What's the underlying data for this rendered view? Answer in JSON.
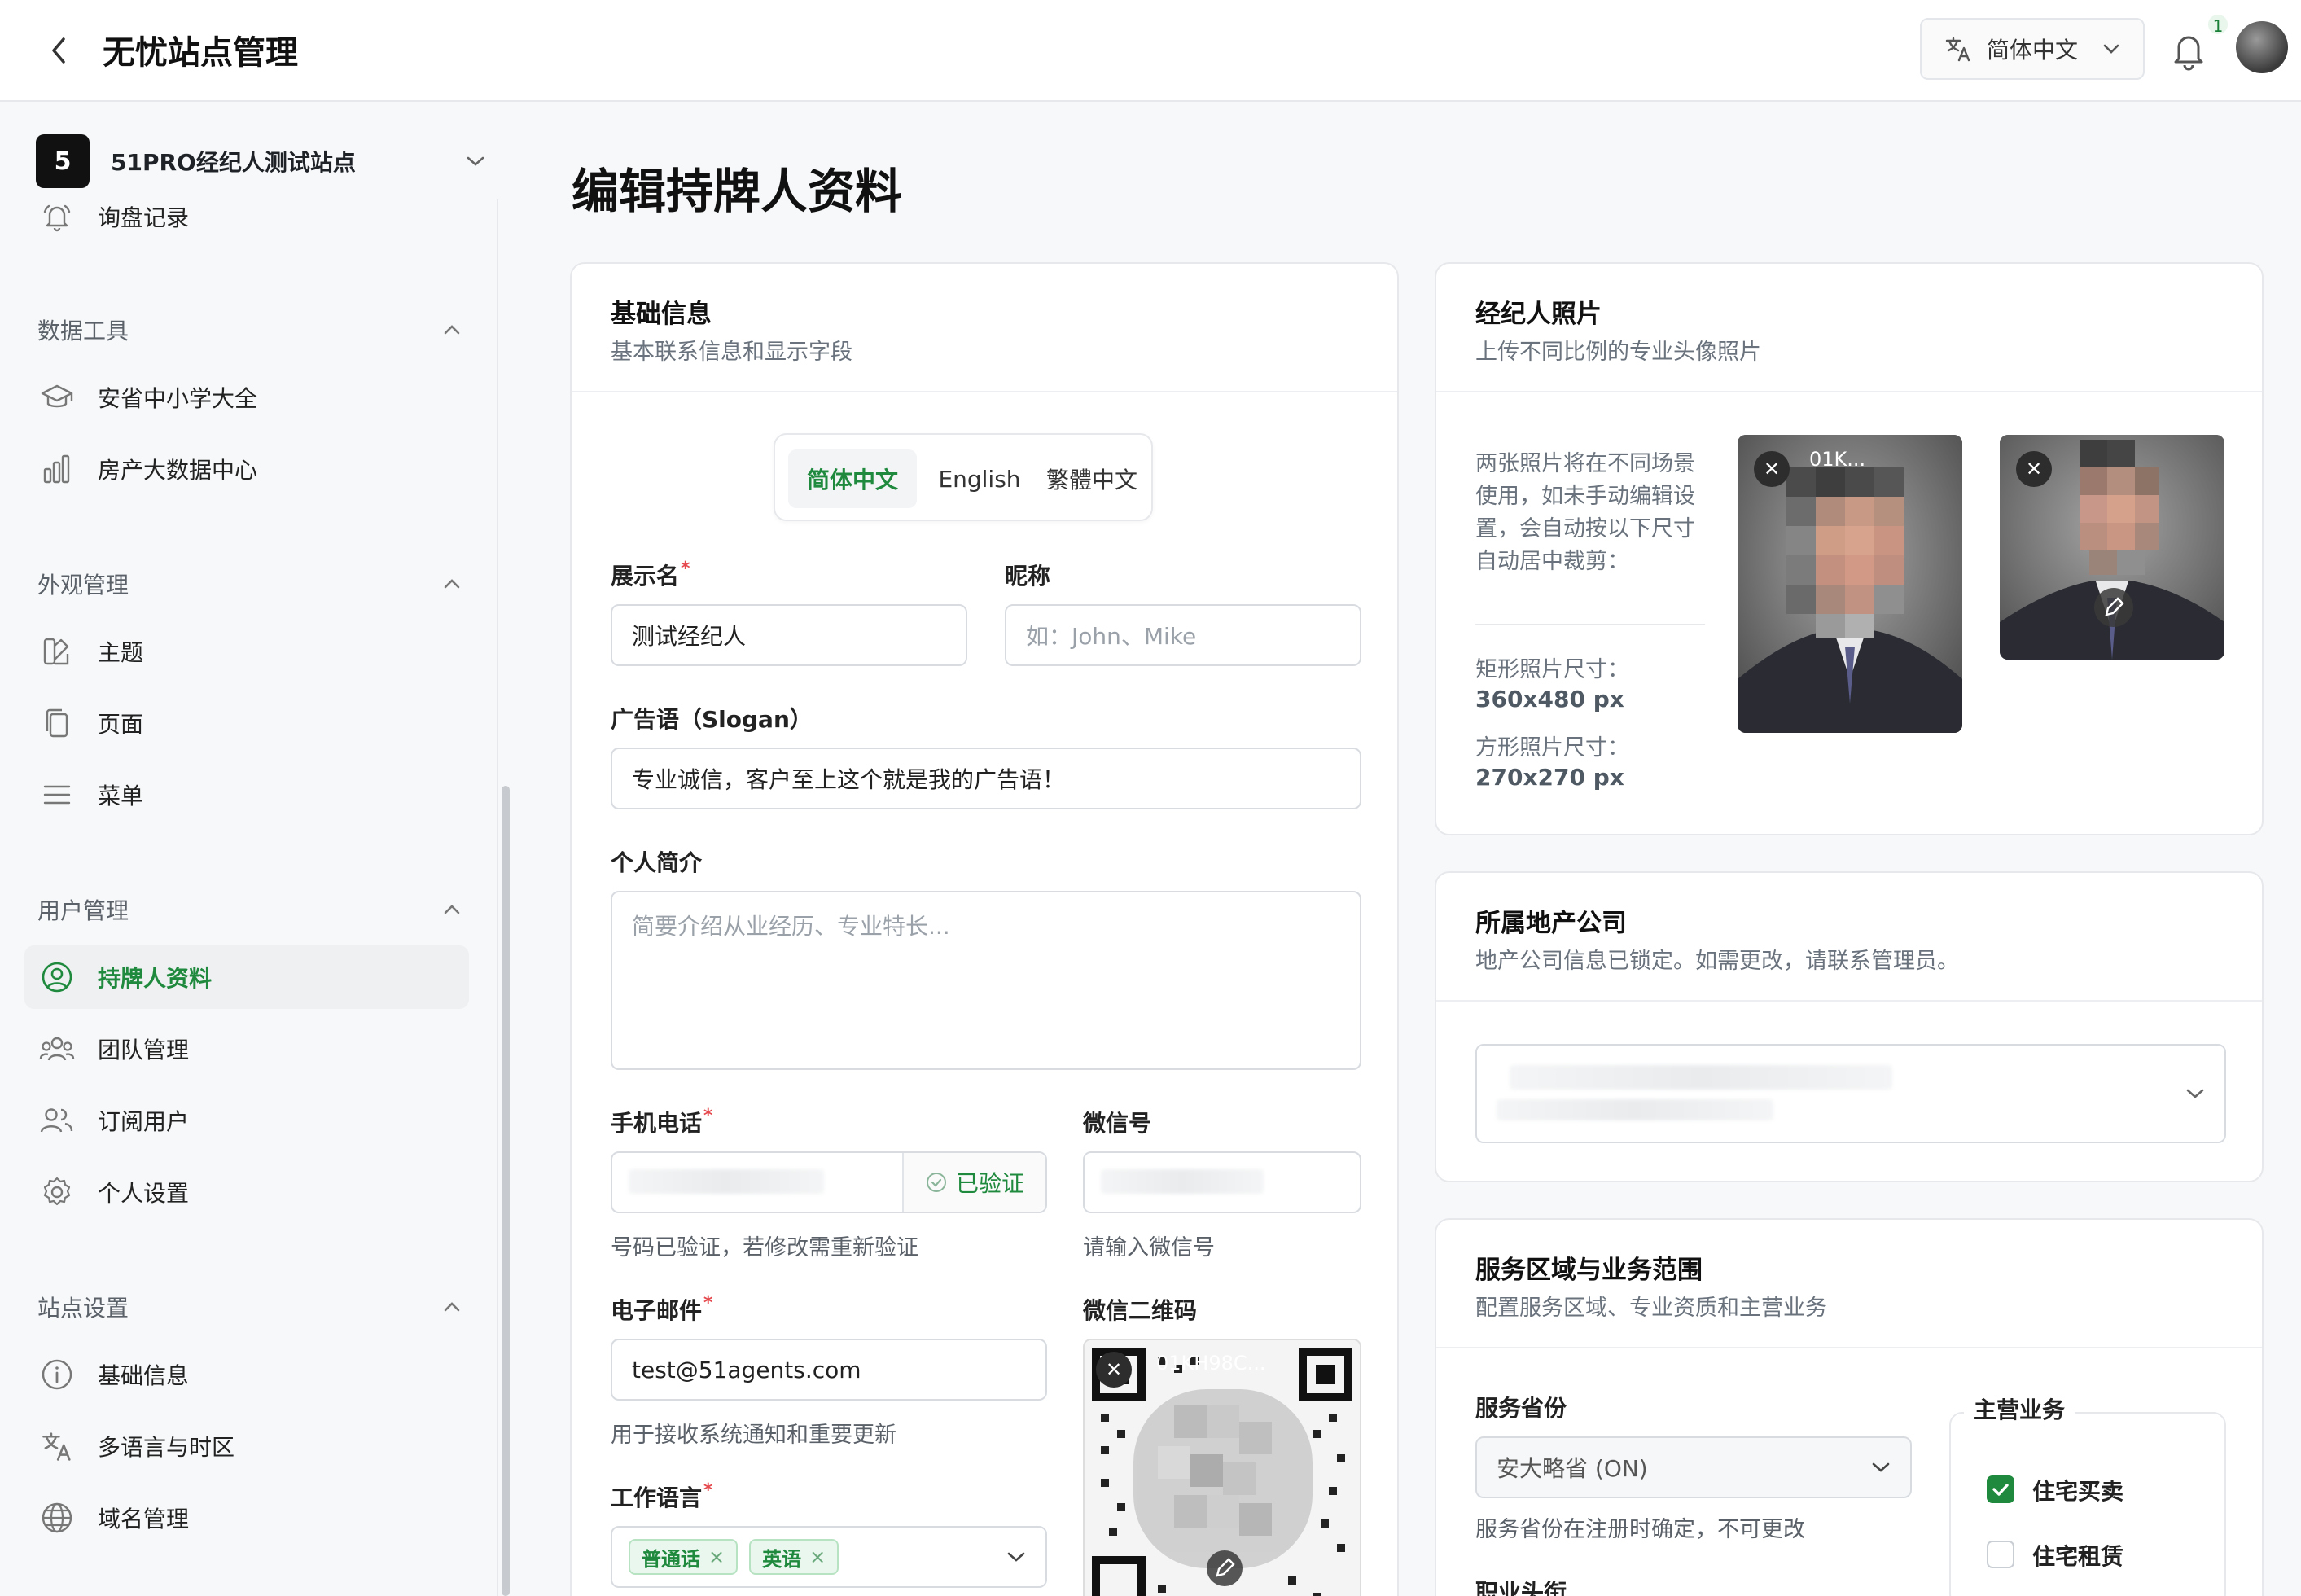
{
  "header": {
    "app_title": "无忧站点管理",
    "language": "简体中文",
    "notification_count": "1"
  },
  "sidebar": {
    "site_number": "5",
    "site_name": "51PRO经纪人测试站点",
    "top_item": "询盘记录",
    "sections": {
      "data_tools": "数据工具",
      "appearance": "外观管理",
      "users": "用户管理",
      "site_settings": "站点设置"
    },
    "items": {
      "schools": "安省中小学大全",
      "real_estate_data": "房产大数据中心",
      "theme": "主题",
      "pages": "页面",
      "menu": "菜单",
      "license_profile": "持牌人资料",
      "team": "团队管理",
      "subscribers": "订阅用户",
      "personal_settings": "个人设置",
      "basic_info": "基础信息",
      "language_timezone": "多语言与时区",
      "domain": "域名管理"
    }
  },
  "main": {
    "page_title": "编辑持牌人资料",
    "basic_card": {
      "title": "基础信息",
      "desc": "基本联系信息和显示字段",
      "tabs": [
        "简体中文",
        "English",
        "繁體中文"
      ],
      "display_name_label": "展示名",
      "display_name_value": "测试经纪人",
      "nickname_label": "昵称",
      "nickname_placeholder": "如：John、Mike",
      "slogan_label": "广告语（Slogan）",
      "slogan_value": "专业诚信，客户至上这个就是我的广告语！",
      "bio_label": "个人简介",
      "bio_placeholder": "简要介绍从业经历、专业特长...",
      "phone_label": "手机电话",
      "phone_verified": "已验证",
      "phone_help": "号码已验证，若修改需重新验证",
      "wechat_label": "微信号",
      "wechat_help": "请输入微信号",
      "email_label": "电子邮件",
      "email_value": "test@51agents.com",
      "email_help": "用于接收系统通知和重要更新",
      "wechat_qr_label": "微信二维码",
      "qr_file_name": "01KH98C...",
      "work_lang_label": "工作语言",
      "work_lang_tags": [
        "普通话",
        "英语"
      ]
    },
    "photo_card": {
      "title": "经纪人照片",
      "desc": "上传不同比例的专业头像照片",
      "note": "两张照片将在不同场景使用，如未手动编辑设置，会自动按以下尺寸自动居中裁剪：",
      "rect_label": "矩形照片尺寸：",
      "rect_value": "360x480 px",
      "square_label": "方形照片尺寸：",
      "square_value": "270x270 px",
      "rect_file_name": "01K..."
    },
    "company_card": {
      "title": "所属地产公司",
      "desc": "地产公司信息已锁定。如需更改，请联系管理员。"
    },
    "service_card": {
      "title": "服务区域与业务范围",
      "desc": "配置服务区域、专业资质和主营业务",
      "province_label": "服务省份",
      "province_value": "安大略省 (ON)",
      "province_help": "服务省份在注册时确定，不可更改",
      "next_label": "职业头衔",
      "business_label": "主营业务",
      "business_items": [
        {
          "label": "住宅买卖",
          "checked": true
        },
        {
          "label": "住宅租赁",
          "checked": false
        }
      ]
    }
  },
  "colors": {
    "accent": "#1f8a3d",
    "required": "#e5484d"
  }
}
